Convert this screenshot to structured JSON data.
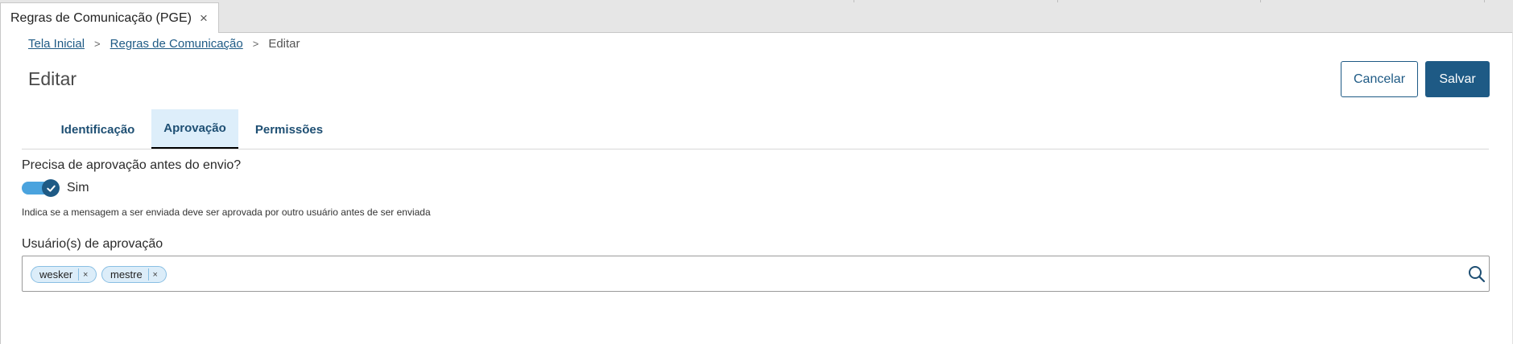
{
  "window_tab": {
    "title": "Regras de Comunicação (PGE)",
    "close_glyph": "×"
  },
  "breadcrumb": {
    "items": [
      "Tela Inicial",
      "Regras de Comunicação"
    ],
    "current": "Editar",
    "separator": ">"
  },
  "page": {
    "title": "Editar"
  },
  "actions": {
    "cancel_label": "Cancelar",
    "save_label": "Salvar"
  },
  "tabs": [
    {
      "label": "Identificação",
      "active": false
    },
    {
      "label": "Aprovação",
      "active": true
    },
    {
      "label": "Permissões",
      "active": false
    }
  ],
  "approval": {
    "question": "Precisa de aprovação antes do envio?",
    "toggle_on": true,
    "toggle_label": "Sim",
    "help_text": "Indica se a mensagem a ser enviada deve ser aprovada por outro usuário antes de ser enviada"
  },
  "approvers": {
    "label": "Usuário(s) de aprovação",
    "chips": [
      "wesker",
      "mestre"
    ],
    "chip_remove_glyph": "×",
    "search_icon": "search-icon"
  },
  "colors": {
    "primary": "#1e5a85",
    "toggle_track": "#4aa3de",
    "active_tab_bg": "#ddeefa",
    "chip_bg": "#dcedf9"
  }
}
